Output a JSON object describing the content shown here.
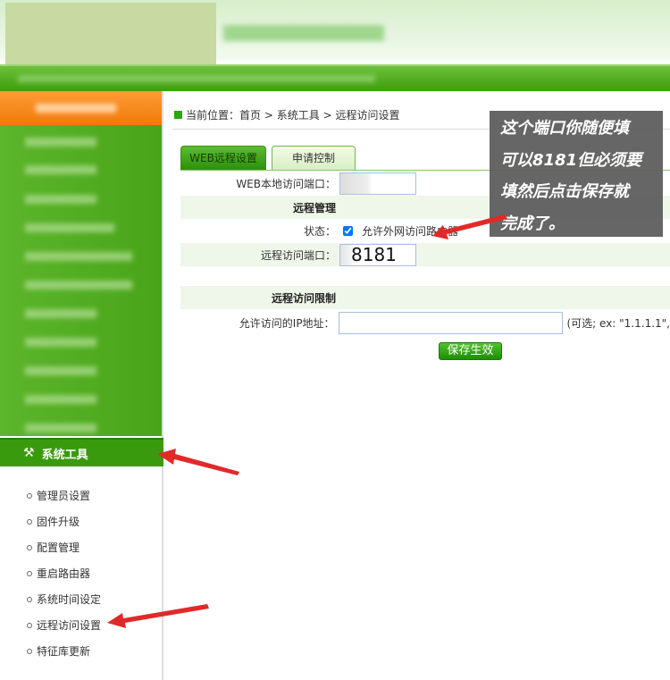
{
  "breadcrumb": {
    "label": "当前位置：",
    "home": "首页",
    "sep1": ">",
    "section": "系统工具",
    "sep2": ">",
    "page": "远程访问设置"
  },
  "tabs": [
    {
      "label": "WEB远程设置"
    },
    {
      "label": "申请控制"
    }
  ],
  "form": {
    "local_port_label": "WEB本地访问端口：",
    "remote_mgmt_heading": "远程管理",
    "status_label": "状态：",
    "status_checkbox_label": "允许外网访问路由器",
    "status_checked": true,
    "remote_port_label": "远程访问端口：",
    "remote_port_value": "8181",
    "restrict_heading": "远程访问限制",
    "ip_label": "允许访问的IP地址：",
    "ip_value": "",
    "ip_hint": "(可选; ex: \"1.1.1.1\",",
    "save_label": "保存生效"
  },
  "sidebar": {
    "active_section": "系统工具",
    "submenu": [
      "管理员设置",
      "固件升级",
      "配置管理",
      "重启路由器",
      "系统时间设定",
      "远程访问设置",
      "特征库更新"
    ]
  },
  "annotation": "这个端口你随便填可以8181但必须要填然后点击保存就完成了。",
  "annotation_lines": [
    "这个端口你随便填",
    "可以8181但必须要",
    "填然后点击保存就",
    "完成了。"
  ],
  "colors": {
    "accent": "#3a9a0e",
    "arrow": "#e02a2a"
  }
}
